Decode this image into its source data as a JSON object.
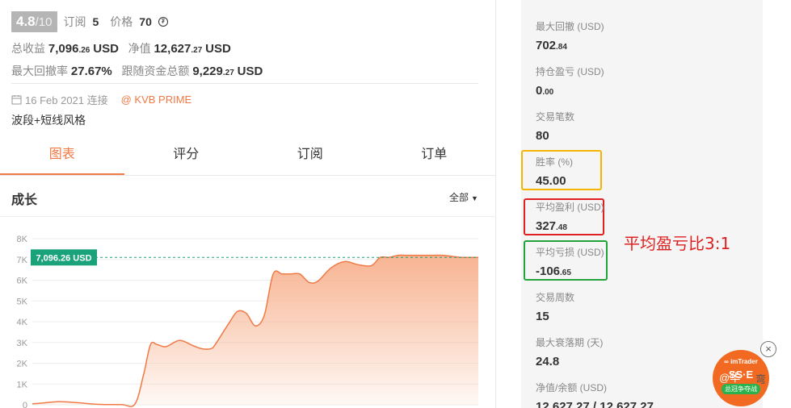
{
  "header": {
    "score": "4.8",
    "score_denom": "/10",
    "subs_label": "订阅",
    "subs_value": "5",
    "price_label": "价格",
    "price_value": "70"
  },
  "summary": {
    "total_profit_label": "总收益",
    "total_profit_main": "7,096",
    "total_profit_dec": ".26",
    "total_profit_unit": "USD",
    "equity_label": "净值",
    "equity_main": "12,627",
    "equity_dec": ".27",
    "equity_unit": "USD",
    "max_dd_label": "最大回撤率",
    "max_dd_value": "27.67%",
    "follow_label": "跟随资金总额",
    "follow_main": "9,229",
    "follow_dec": ".27",
    "follow_unit": "USD"
  },
  "info": {
    "date": "16 Feb 2021 连接",
    "broker": "@ KVB PRIME",
    "style": "波段+短线风格"
  },
  "tabs": [
    "图表",
    "评分",
    "订阅",
    "订单"
  ],
  "growth": {
    "title": "成长",
    "filter": "全部"
  },
  "chart_data": {
    "type": "area",
    "y_ticks": [
      "8K",
      "7K",
      "6K",
      "5K",
      "4K",
      "3K",
      "2K",
      "1K",
      "0"
    ],
    "ylim": [
      0,
      8000
    ],
    "current_label": "7,096.26 USD",
    "current_value": 7096.26,
    "colors": {
      "line": "#f07a45",
      "fill": "#f7b08c",
      "badge": "#1aa37a"
    },
    "x": [
      0,
      0.02,
      0.06,
      0.1,
      0.15,
      0.2,
      0.23,
      0.25,
      0.265,
      0.28,
      0.3,
      0.33,
      0.36,
      0.38,
      0.4,
      0.41,
      0.44,
      0.46,
      0.48,
      0.5,
      0.52,
      0.54,
      0.56,
      0.58,
      0.6,
      0.62,
      0.64,
      0.67,
      0.7,
      0.73,
      0.76,
      0.78,
      0.8,
      0.82,
      0.84,
      0.86,
      0.88,
      0.9,
      0.92,
      0.94,
      0.96,
      0.98,
      1.0
    ],
    "values": [
      50,
      80,
      150,
      100,
      20,
      10,
      30,
      1500,
      2900,
      2900,
      2800,
      3100,
      2850,
      2700,
      2700,
      2900,
      3900,
      4500,
      4400,
      3800,
      4300,
      6300,
      6300,
      6300,
      6300,
      5900,
      5950,
      6600,
      6900,
      6750,
      6700,
      7100,
      7100,
      7200,
      7200,
      7200,
      7200,
      7200,
      7200,
      7150,
      7100,
      7096,
      7096
    ]
  },
  "stats": [
    {
      "label": "最大回撤 (USD)",
      "main": "702",
      "dec": ".84"
    },
    {
      "label": "持仓盈亏 (USD)",
      "main": "0",
      "dec": ".00"
    },
    {
      "label": "交易笔数",
      "main": "80",
      "dec": ""
    },
    {
      "label": "胜率 (%)",
      "main": "45.00",
      "dec": ""
    },
    {
      "label": "平均盈利 (USD)",
      "main": "327",
      "dec": ".48"
    },
    {
      "label": "平均亏损 (USD)",
      "main": "-106",
      "dec": ".65"
    },
    {
      "label": "交易周数",
      "main": "15",
      "dec": ""
    },
    {
      "label": "最大衰落期 (天)",
      "main": "24.8",
      "dec": ""
    },
    {
      "label": "净值/余额 (USD)",
      "main": "12,627.27 / 12,627.27",
      "dec": ""
    }
  ],
  "annotation": "平均盈亏比3:1",
  "promo": {
    "brand": "∞ imTrader",
    "main": "SS·E",
    "tag": "总冠争夺战",
    "overlay": "@华",
    "side": "弯"
  }
}
